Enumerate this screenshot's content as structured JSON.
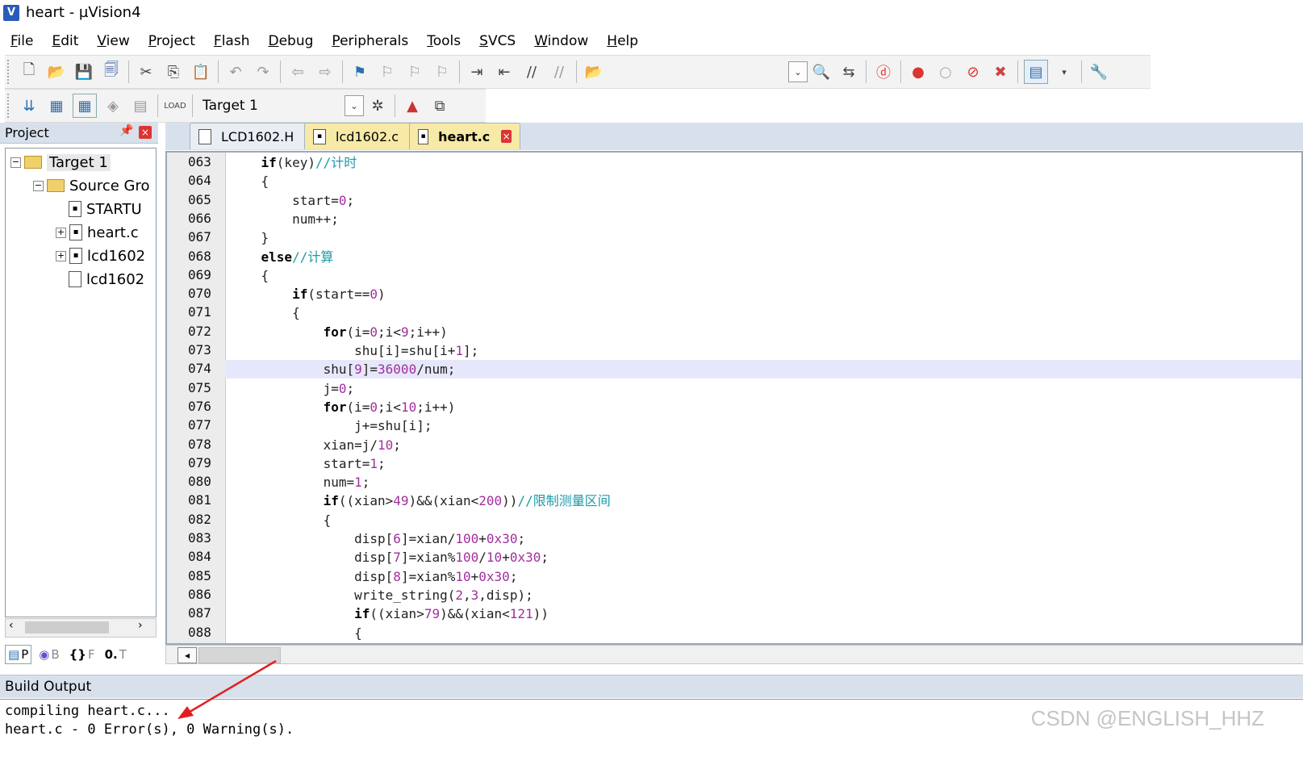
{
  "window": {
    "title": "heart  - µVision4"
  },
  "menu": [
    "File",
    "Edit",
    "View",
    "Project",
    "Flash",
    "Debug",
    "Peripherals",
    "Tools",
    "SVCS",
    "Window",
    "Help"
  ],
  "toolbar2": {
    "target": "Target 1"
  },
  "project_panel": {
    "title": "Project",
    "tree": [
      {
        "label": "Target 1"
      },
      {
        "label": "Source Gro"
      },
      {
        "label": "STARTU"
      },
      {
        "label": "heart.c"
      },
      {
        "label": "lcd1602"
      },
      {
        "label": "lcd1602"
      }
    ],
    "tabs": [
      "P",
      "B",
      "F",
      "T"
    ]
  },
  "editor": {
    "tabs": [
      {
        "label": "LCD1602.H"
      },
      {
        "label": "lcd1602.c"
      },
      {
        "label": "heart.c"
      }
    ],
    "line_numbers": [
      "063",
      "064",
      "065",
      "066",
      "067",
      "068",
      "069",
      "070",
      "071",
      "072",
      "073",
      "074",
      "075",
      "076",
      "077",
      "078",
      "079",
      "080",
      "081",
      "082",
      "083",
      "084",
      "085",
      "086",
      "087",
      "088"
    ],
    "lines": [
      "    if(key)//计时",
      "    {",
      "        start=0;",
      "        num++;",
      "    }",
      "    else//计算",
      "    {",
      "        if(start==0)",
      "        {",
      "            for(i=0;i<9;i++)",
      "                shu[i]=shu[i+1];",
      "            shu[9]=36000/num;",
      "            j=0;",
      "            for(i=0;i<10;i++)",
      "                j+=shu[i];",
      "            xian=j/10;",
      "            start=1;",
      "            num=1;",
      "            if((xian>49)&&(xian<200))//限制测量区间",
      "            {",
      "                disp[6]=xian/100+0x30;",
      "                disp[7]=xian%100/10+0x30;",
      "                disp[8]=xian%10+0x30;",
      "                write_string(2,3,disp);",
      "                if((xian>79)&&(xian<121))",
      "                {"
    ]
  },
  "build_output": {
    "title": "Build Output",
    "lines": [
      "compiling heart.c...",
      "heart.c - 0 Error(s), 0 Warning(s)."
    ]
  },
  "watermark": "CSDN @ENGLISH_HHZ",
  "colors": {
    "accent_red": "#d33333",
    "highlight_line": "#e7e7fb",
    "comment": "#1b9aa8"
  }
}
